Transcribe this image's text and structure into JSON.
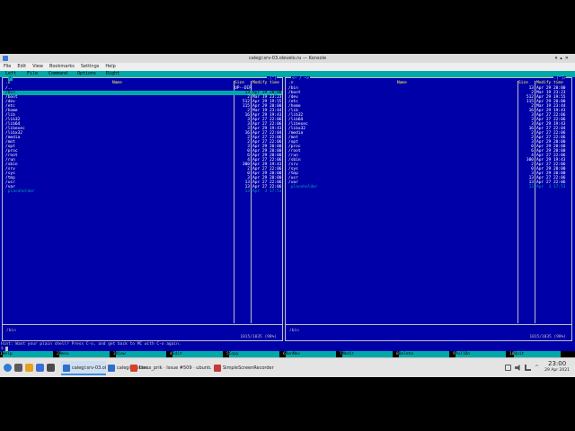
{
  "window": {
    "title": "calegi:srv-03.olevelo.ru — Konsole"
  },
  "menubar": [
    "File",
    "Edit",
    "View",
    "Bookmarks",
    "Settings",
    "Help"
  ],
  "mc_menu": [
    "Left",
    "File",
    "Command",
    "Options",
    "Right"
  ],
  "left_panel": {
    "path": ".[^]",
    "path_text": "/",
    "corner": "<─ ~ ─>",
    "headers": {
      "name_col": ".n",
      "name": "Name",
      "size": "Size",
      "mtime": "Modify time"
    },
    "rows": [
      {
        "name": "/..",
        "size": "UP--DIR",
        "mtime": "",
        "type": "updir"
      },
      {
        "name": "/bin",
        "size": "13",
        "mtime": "Apr 29 20:00",
        "type": "sel"
      },
      {
        "name": "/boot",
        "size": "2",
        "mtime": "Mar 19 23:23",
        "type": "dir"
      },
      {
        "name": "/dev",
        "size": "512",
        "mtime": "Apr 29 19:55",
        "type": "dir"
      },
      {
        "name": "/etc",
        "size": "115",
        "mtime": "Apr 29 20:00",
        "type": "dir"
      },
      {
        "name": "/home",
        "size": "2",
        "mtime": "Mar 19 23:44",
        "type": "dir"
      },
      {
        "name": "/lib",
        "size": "16",
        "mtime": "Apr 29 19:43",
        "type": "dir"
      },
      {
        "name": "/lib32",
        "size": "3",
        "mtime": "Apr 27 22:06",
        "type": "dir"
      },
      {
        "name": "/lib64",
        "size": "3",
        "mtime": "Apr 27 22:06",
        "type": "dir"
      },
      {
        "name": "/libexec",
        "size": "3",
        "mtime": "Apr 29 19:43",
        "type": "dir"
      },
      {
        "name": "/libx32",
        "size": "16",
        "mtime": "Apr 27 22:04",
        "type": "dir"
      },
      {
        "name": "/media",
        "size": "2",
        "mtime": "Apr 27 22:06",
        "type": "dir"
      },
      {
        "name": "/mnt",
        "size": "2",
        "mtime": "Apr 27 22:06",
        "type": "dir"
      },
      {
        "name": "/opt",
        "size": "3",
        "mtime": "Apr 29 20:00",
        "type": "dir"
      },
      {
        "name": "/proc",
        "size": "0",
        "mtime": "Apr 29 20:00",
        "type": "dir"
      },
      {
        "name": "/root",
        "size": "6",
        "mtime": "Apr 29 20:00",
        "type": "dir"
      },
      {
        "name": "/run",
        "size": "4",
        "mtime": "Apr 27 22:06",
        "type": "dir"
      },
      {
        "name": "/sbin",
        "size": "300",
        "mtime": "Apr 29 19:43",
        "type": "dir"
      },
      {
        "name": "/srv",
        "size": "2",
        "mtime": "Apr 27 22:06",
        "type": "dir"
      },
      {
        "name": "/sys",
        "size": "0",
        "mtime": "Apr 29 20:00",
        "type": "dir"
      },
      {
        "name": "/tmp",
        "size": "3",
        "mtime": "Apr 29 20:00",
        "type": "dir"
      },
      {
        "name": "/usr",
        "size": "13",
        "mtime": "Apr 27 22:06",
        "type": "dir"
      },
      {
        "name": "/var",
        "size": "13",
        "mtime": "Apr 27 22:06",
        "type": "dir"
      },
      {
        "name": " placeholder",
        "size": "13",
        "mtime": "Apr  3 17:53",
        "type": "file"
      }
    ],
    "footer": "/bin",
    "status": "1015/1035 (98%)"
  },
  "right_panel": {
    "path": "<─ / ─>",
    "corner": ".[^]>",
    "headers": {
      "name_col": ".n",
      "name": "Name",
      "size": "Size",
      "mtime": "Modify time"
    },
    "rows": [
      {
        "name": "/bin",
        "size": "13",
        "mtime": "Apr 29 20:00",
        "type": "dir"
      },
      {
        "name": "/boot",
        "size": "2",
        "mtime": "Mar 19 23:23",
        "type": "dir"
      },
      {
        "name": "/dev",
        "size": "512",
        "mtime": "Apr 29 19:55",
        "type": "dir"
      },
      {
        "name": "/etc",
        "size": "115",
        "mtime": "Apr 29 20:00",
        "type": "dir"
      },
      {
        "name": "/home",
        "size": "2",
        "mtime": "Mar 19 23:44",
        "type": "dir"
      },
      {
        "name": "/lib",
        "size": "16",
        "mtime": "Apr 29 19:43",
        "type": "dir"
      },
      {
        "name": "/lib32",
        "size": "3",
        "mtime": "Apr 27 22:06",
        "type": "dir"
      },
      {
        "name": "/lib64",
        "size": "3",
        "mtime": "Apr 27 22:06",
        "type": "dir"
      },
      {
        "name": "/libexec",
        "size": "3",
        "mtime": "Apr 29 19:43",
        "type": "dir"
      },
      {
        "name": "/libx32",
        "size": "16",
        "mtime": "Apr 27 22:04",
        "type": "dir"
      },
      {
        "name": "/media",
        "size": "2",
        "mtime": "Apr 27 22:06",
        "type": "dir"
      },
      {
        "name": "/mnt",
        "size": "2",
        "mtime": "Apr 27 22:06",
        "type": "dir"
      },
      {
        "name": "/opt",
        "size": "3",
        "mtime": "Apr 29 20:00",
        "type": "dir"
      },
      {
        "name": "/proc",
        "size": "0",
        "mtime": "Apr 29 20:00",
        "type": "dir"
      },
      {
        "name": "/root",
        "size": "6",
        "mtime": "Apr 29 20:00",
        "type": "dir"
      },
      {
        "name": "/run",
        "size": "4",
        "mtime": "Apr 27 22:06",
        "type": "dir"
      },
      {
        "name": "/sbin",
        "size": "300",
        "mtime": "Apr 29 19:43",
        "type": "dir"
      },
      {
        "name": "/srv",
        "size": "2",
        "mtime": "Apr 27 22:06",
        "type": "dir"
      },
      {
        "name": "/sys",
        "size": "0",
        "mtime": "Apr 29 20:00",
        "type": "dir"
      },
      {
        "name": "/tmp",
        "size": "3",
        "mtime": "Apr 29 20:00",
        "type": "dir"
      },
      {
        "name": "/usr",
        "size": "13",
        "mtime": "Apr 27 22:06",
        "type": "dir"
      },
      {
        "name": "/var",
        "size": "13",
        "mtime": "Apr 27 22:06",
        "type": "dir"
      },
      {
        "name": " placeholder",
        "size": "13",
        "mtime": "Apr  3 17:53",
        "type": "file"
      }
    ],
    "footer": "/bin",
    "status": "1015/1035 (98%)"
  },
  "hint": "Hint: Want your plain shell? Press C-o, and get back to MC with C-o again.",
  "prompt": "$",
  "fkeys": [
    {
      "num": "1",
      "label": "Help"
    },
    {
      "num": "2",
      "label": "Menu"
    },
    {
      "num": "3",
      "label": "View"
    },
    {
      "num": "4",
      "label": "Edit"
    },
    {
      "num": "5",
      "label": "Copy"
    },
    {
      "num": "6",
      "label": "RenMov"
    },
    {
      "num": "7",
      "label": "Mkdir"
    },
    {
      "num": "8",
      "label": "Delete"
    },
    {
      "num": "9",
      "label": "PullDn"
    },
    {
      "num": "10",
      "label": "Quit"
    }
  ],
  "taskbar": {
    "tasks": [
      {
        "label": "calegi:srv-03.olevelo.ru — Konsole",
        "active": true,
        "color": "#2f6fc9"
      },
      {
        "label": "calegi:mother.olevelo.ru",
        "active": false,
        "color": "#2f6fc9"
      },
      {
        "label": "Linux_prik · Issue #509 · ubuntu/ubun...",
        "active": false,
        "color": "#d6402c"
      },
      {
        "label": "SimpleScreenRecorder",
        "active": false,
        "color": "#c23a3a"
      }
    ],
    "clock_time": "23:00",
    "clock_date": "29 Apr 2021"
  }
}
